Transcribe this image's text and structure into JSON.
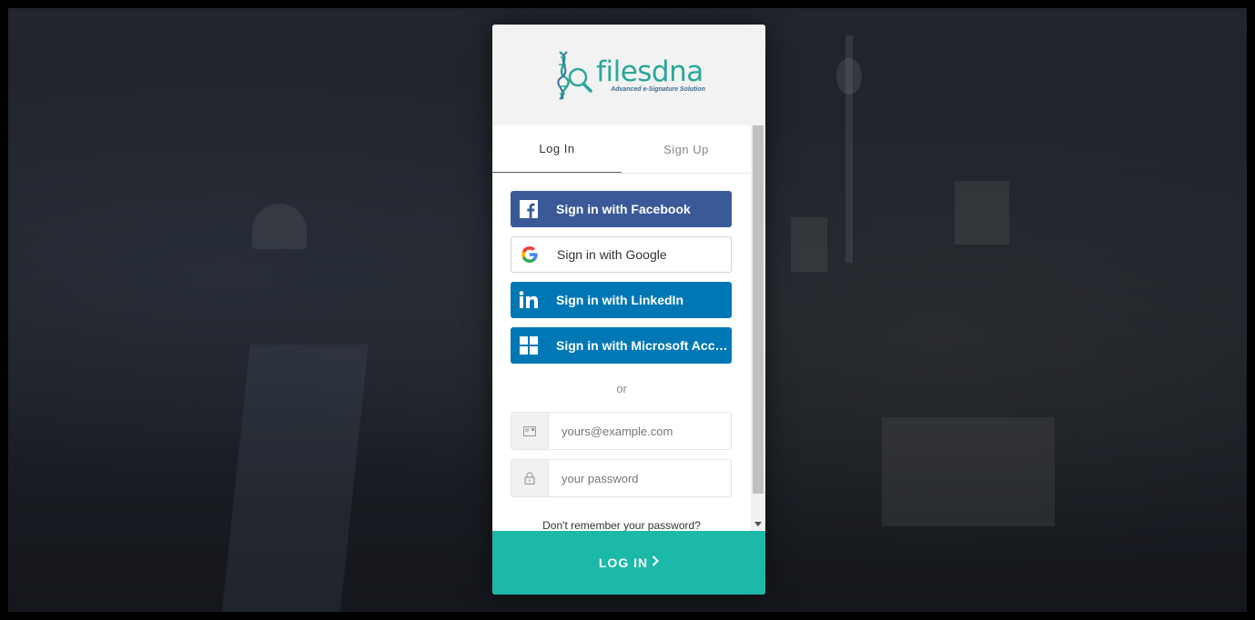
{
  "brand": {
    "name": "filesdna",
    "tagline": "Advanced e-Signature Solution"
  },
  "tabs": [
    {
      "label": "Log In",
      "active": true
    },
    {
      "label": "Sign Up",
      "active": false
    }
  ],
  "social": {
    "facebook": "Sign in with Facebook",
    "google": "Sign in with Google",
    "linkedin": "Sign in with LinkedIn",
    "microsoft": "Sign in with Microsoft Account"
  },
  "separator": "or",
  "form": {
    "email_placeholder": "yours@example.com",
    "password_placeholder": "your password",
    "forgot_link": "Don't remember your password?"
  },
  "submit": {
    "label": "LOG IN",
    "icon": "chevron-right-icon"
  },
  "colors": {
    "accent": "#1cb8a8",
    "facebook": "#3b5998",
    "linkedin": "#0077b5",
    "microsoft": "#0078b6",
    "brand_teal": "#2aa79a"
  }
}
